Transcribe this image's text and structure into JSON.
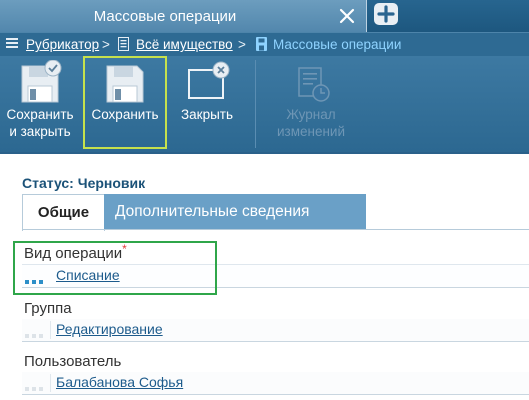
{
  "window": {
    "tab_title": "Массовые операции"
  },
  "breadcrumb": {
    "items": [
      "Рубрикатор",
      "Всё имущество",
      "Массовые операции"
    ],
    "separator": ">"
  },
  "toolbar": {
    "save_close_label_1": "Сохранить",
    "save_close_label_2": "и закрыть",
    "save_label": "Сохранить",
    "close_label": "Закрыть",
    "journal_label_1": "Журнал",
    "journal_label_2": "изменений"
  },
  "form": {
    "status": "Статус: Черновик",
    "tabs": [
      "Общие",
      "Дополнительные сведения"
    ],
    "fields": [
      {
        "label": "Вид операции",
        "required_mark": "*",
        "value": "Списание"
      },
      {
        "label": "Группа",
        "value": "Редактирование"
      },
      {
        "label": "Пользователь",
        "value": "Балабанова Софья"
      }
    ]
  },
  "colors": {
    "header_bg": "#1d577f",
    "tab_bg": "#5f93b8",
    "toolbar_bg": "#3470998",
    "link": "#1d5b8c",
    "highlight_green": "#2fa64a",
    "highlight_lime": "#c6e14c"
  }
}
